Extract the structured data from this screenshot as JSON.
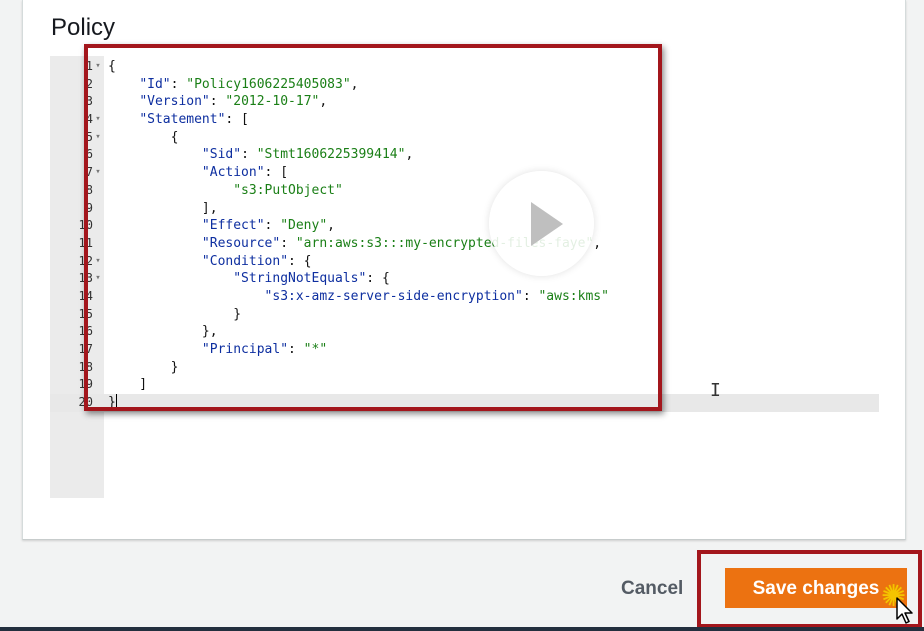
{
  "policy_title": "Policy",
  "editor": {
    "lines": [
      {
        "n": "1",
        "fold": "▾",
        "segs": [
          [
            "p",
            "{"
          ]
        ]
      },
      {
        "n": "2",
        "fold": "",
        "segs": [
          [
            "p",
            "    "
          ],
          [
            "k",
            "\"Id\""
          ],
          [
            "p",
            ": "
          ],
          [
            "s",
            "\"Policy1606225405083\""
          ],
          [
            "p",
            ","
          ]
        ]
      },
      {
        "n": "3",
        "fold": "",
        "segs": [
          [
            "p",
            "    "
          ],
          [
            "k",
            "\"Version\""
          ],
          [
            "p",
            ": "
          ],
          [
            "s",
            "\"2012-10-17\""
          ],
          [
            "p",
            ","
          ]
        ]
      },
      {
        "n": "4",
        "fold": "▾",
        "segs": [
          [
            "p",
            "    "
          ],
          [
            "k",
            "\"Statement\""
          ],
          [
            "p",
            ": ["
          ]
        ]
      },
      {
        "n": "5",
        "fold": "▾",
        "segs": [
          [
            "p",
            "        {"
          ]
        ]
      },
      {
        "n": "6",
        "fold": "",
        "segs": [
          [
            "p",
            "            "
          ],
          [
            "k",
            "\"Sid\""
          ],
          [
            "p",
            ": "
          ],
          [
            "s",
            "\"Stmt1606225399414\""
          ],
          [
            "p",
            ","
          ]
        ]
      },
      {
        "n": "7",
        "fold": "▾",
        "segs": [
          [
            "p",
            "            "
          ],
          [
            "k",
            "\"Action\""
          ],
          [
            "p",
            ": ["
          ]
        ]
      },
      {
        "n": "8",
        "fold": "",
        "segs": [
          [
            "p",
            "                "
          ],
          [
            "s",
            "\"s3:PutObject\""
          ]
        ]
      },
      {
        "n": "9",
        "fold": "",
        "segs": [
          [
            "p",
            "            ],"
          ]
        ]
      },
      {
        "n": "10",
        "fold": "",
        "segs": [
          [
            "p",
            "            "
          ],
          [
            "k",
            "\"Effect\""
          ],
          [
            "p",
            ": "
          ],
          [
            "s",
            "\"Deny\""
          ],
          [
            "p",
            ","
          ]
        ]
      },
      {
        "n": "11",
        "fold": "",
        "segs": [
          [
            "p",
            "            "
          ],
          [
            "k",
            "\"Resource\""
          ],
          [
            "p",
            ": "
          ],
          [
            "s",
            "\"arn:aws:s3:::my-encrypted-files-faye\""
          ],
          [
            "p",
            ","
          ]
        ]
      },
      {
        "n": "12",
        "fold": "▾",
        "segs": [
          [
            "p",
            "            "
          ],
          [
            "k",
            "\"Condition\""
          ],
          [
            "p",
            ": {"
          ]
        ]
      },
      {
        "n": "13",
        "fold": "▾",
        "segs": [
          [
            "p",
            "                "
          ],
          [
            "k",
            "\"StringNotEquals\""
          ],
          [
            "p",
            ": {"
          ]
        ]
      },
      {
        "n": "14",
        "fold": "",
        "segs": [
          [
            "p",
            "                    "
          ],
          [
            "k",
            "\"s3:x-amz-server-side-encryption\""
          ],
          [
            "p",
            ": "
          ],
          [
            "s",
            "\"aws:kms\""
          ]
        ]
      },
      {
        "n": "15",
        "fold": "",
        "segs": [
          [
            "p",
            "                }"
          ]
        ]
      },
      {
        "n": "16",
        "fold": "",
        "segs": [
          [
            "p",
            "            },"
          ]
        ]
      },
      {
        "n": "17",
        "fold": "",
        "segs": [
          [
            "p",
            "            "
          ],
          [
            "k",
            "\"Principal\""
          ],
          [
            "p",
            ": "
          ],
          [
            "s",
            "\"*\""
          ]
        ]
      },
      {
        "n": "18",
        "fold": "",
        "segs": [
          [
            "p",
            "        }"
          ]
        ]
      },
      {
        "n": "19",
        "fold": "",
        "segs": [
          [
            "p",
            "    ]"
          ]
        ]
      },
      {
        "n": "20",
        "fold": "",
        "segs": [
          [
            "p",
            "}"
          ]
        ],
        "active": true
      }
    ]
  },
  "buttons": {
    "cancel": "Cancel",
    "save": "Save changes"
  },
  "colors": {
    "accent": "#ec7211",
    "highlight": "#a3161c",
    "json_key": "#0e2fa0",
    "json_string": "#1a7f16"
  },
  "icons": {
    "play": "play-icon",
    "pointer": "mouse-pointer-icon",
    "text_cursor": "text-cursor-icon",
    "click": "click-burst-icon"
  }
}
